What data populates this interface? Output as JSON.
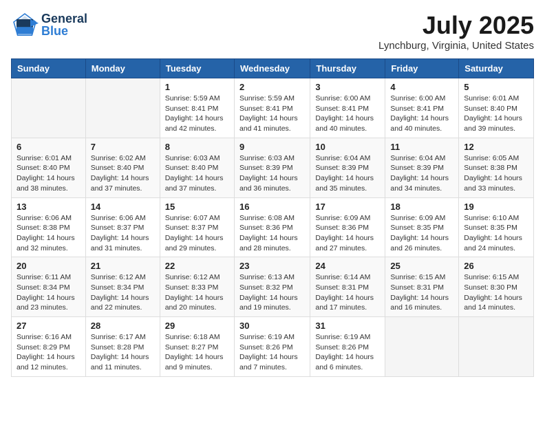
{
  "header": {
    "logo_general": "General",
    "logo_blue": "Blue",
    "month_title": "July 2025",
    "location": "Lynchburg, Virginia, United States"
  },
  "weekdays": [
    "Sunday",
    "Monday",
    "Tuesday",
    "Wednesday",
    "Thursday",
    "Friday",
    "Saturday"
  ],
  "weeks": [
    [
      {
        "day": "",
        "sunrise": "",
        "sunset": "",
        "daylight": ""
      },
      {
        "day": "",
        "sunrise": "",
        "sunset": "",
        "daylight": ""
      },
      {
        "day": "1",
        "sunrise": "Sunrise: 5:59 AM",
        "sunset": "Sunset: 8:41 PM",
        "daylight": "Daylight: 14 hours and 42 minutes."
      },
      {
        "day": "2",
        "sunrise": "Sunrise: 5:59 AM",
        "sunset": "Sunset: 8:41 PM",
        "daylight": "Daylight: 14 hours and 41 minutes."
      },
      {
        "day": "3",
        "sunrise": "Sunrise: 6:00 AM",
        "sunset": "Sunset: 8:41 PM",
        "daylight": "Daylight: 14 hours and 40 minutes."
      },
      {
        "day": "4",
        "sunrise": "Sunrise: 6:00 AM",
        "sunset": "Sunset: 8:41 PM",
        "daylight": "Daylight: 14 hours and 40 minutes."
      },
      {
        "day": "5",
        "sunrise": "Sunrise: 6:01 AM",
        "sunset": "Sunset: 8:40 PM",
        "daylight": "Daylight: 14 hours and 39 minutes."
      }
    ],
    [
      {
        "day": "6",
        "sunrise": "Sunrise: 6:01 AM",
        "sunset": "Sunset: 8:40 PM",
        "daylight": "Daylight: 14 hours and 38 minutes."
      },
      {
        "day": "7",
        "sunrise": "Sunrise: 6:02 AM",
        "sunset": "Sunset: 8:40 PM",
        "daylight": "Daylight: 14 hours and 37 minutes."
      },
      {
        "day": "8",
        "sunrise": "Sunrise: 6:03 AM",
        "sunset": "Sunset: 8:40 PM",
        "daylight": "Daylight: 14 hours and 37 minutes."
      },
      {
        "day": "9",
        "sunrise": "Sunrise: 6:03 AM",
        "sunset": "Sunset: 8:39 PM",
        "daylight": "Daylight: 14 hours and 36 minutes."
      },
      {
        "day": "10",
        "sunrise": "Sunrise: 6:04 AM",
        "sunset": "Sunset: 8:39 PM",
        "daylight": "Daylight: 14 hours and 35 minutes."
      },
      {
        "day": "11",
        "sunrise": "Sunrise: 6:04 AM",
        "sunset": "Sunset: 8:39 PM",
        "daylight": "Daylight: 14 hours and 34 minutes."
      },
      {
        "day": "12",
        "sunrise": "Sunrise: 6:05 AM",
        "sunset": "Sunset: 8:38 PM",
        "daylight": "Daylight: 14 hours and 33 minutes."
      }
    ],
    [
      {
        "day": "13",
        "sunrise": "Sunrise: 6:06 AM",
        "sunset": "Sunset: 8:38 PM",
        "daylight": "Daylight: 14 hours and 32 minutes."
      },
      {
        "day": "14",
        "sunrise": "Sunrise: 6:06 AM",
        "sunset": "Sunset: 8:37 PM",
        "daylight": "Daylight: 14 hours and 31 minutes."
      },
      {
        "day": "15",
        "sunrise": "Sunrise: 6:07 AM",
        "sunset": "Sunset: 8:37 PM",
        "daylight": "Daylight: 14 hours and 29 minutes."
      },
      {
        "day": "16",
        "sunrise": "Sunrise: 6:08 AM",
        "sunset": "Sunset: 8:36 PM",
        "daylight": "Daylight: 14 hours and 28 minutes."
      },
      {
        "day": "17",
        "sunrise": "Sunrise: 6:09 AM",
        "sunset": "Sunset: 8:36 PM",
        "daylight": "Daylight: 14 hours and 27 minutes."
      },
      {
        "day": "18",
        "sunrise": "Sunrise: 6:09 AM",
        "sunset": "Sunset: 8:35 PM",
        "daylight": "Daylight: 14 hours and 26 minutes."
      },
      {
        "day": "19",
        "sunrise": "Sunrise: 6:10 AM",
        "sunset": "Sunset: 8:35 PM",
        "daylight": "Daylight: 14 hours and 24 minutes."
      }
    ],
    [
      {
        "day": "20",
        "sunrise": "Sunrise: 6:11 AM",
        "sunset": "Sunset: 8:34 PM",
        "daylight": "Daylight: 14 hours and 23 minutes."
      },
      {
        "day": "21",
        "sunrise": "Sunrise: 6:12 AM",
        "sunset": "Sunset: 8:34 PM",
        "daylight": "Daylight: 14 hours and 22 minutes."
      },
      {
        "day": "22",
        "sunrise": "Sunrise: 6:12 AM",
        "sunset": "Sunset: 8:33 PM",
        "daylight": "Daylight: 14 hours and 20 minutes."
      },
      {
        "day": "23",
        "sunrise": "Sunrise: 6:13 AM",
        "sunset": "Sunset: 8:32 PM",
        "daylight": "Daylight: 14 hours and 19 minutes."
      },
      {
        "day": "24",
        "sunrise": "Sunrise: 6:14 AM",
        "sunset": "Sunset: 8:31 PM",
        "daylight": "Daylight: 14 hours and 17 minutes."
      },
      {
        "day": "25",
        "sunrise": "Sunrise: 6:15 AM",
        "sunset": "Sunset: 8:31 PM",
        "daylight": "Daylight: 14 hours and 16 minutes."
      },
      {
        "day": "26",
        "sunrise": "Sunrise: 6:15 AM",
        "sunset": "Sunset: 8:30 PM",
        "daylight": "Daylight: 14 hours and 14 minutes."
      }
    ],
    [
      {
        "day": "27",
        "sunrise": "Sunrise: 6:16 AM",
        "sunset": "Sunset: 8:29 PM",
        "daylight": "Daylight: 14 hours and 12 minutes."
      },
      {
        "day": "28",
        "sunrise": "Sunrise: 6:17 AM",
        "sunset": "Sunset: 8:28 PM",
        "daylight": "Daylight: 14 hours and 11 minutes."
      },
      {
        "day": "29",
        "sunrise": "Sunrise: 6:18 AM",
        "sunset": "Sunset: 8:27 PM",
        "daylight": "Daylight: 14 hours and 9 minutes."
      },
      {
        "day": "30",
        "sunrise": "Sunrise: 6:19 AM",
        "sunset": "Sunset: 8:26 PM",
        "daylight": "Daylight: 14 hours and 7 minutes."
      },
      {
        "day": "31",
        "sunrise": "Sunrise: 6:19 AM",
        "sunset": "Sunset: 8:26 PM",
        "daylight": "Daylight: 14 hours and 6 minutes."
      },
      {
        "day": "",
        "sunrise": "",
        "sunset": "",
        "daylight": ""
      },
      {
        "day": "",
        "sunrise": "",
        "sunset": "",
        "daylight": ""
      }
    ]
  ]
}
